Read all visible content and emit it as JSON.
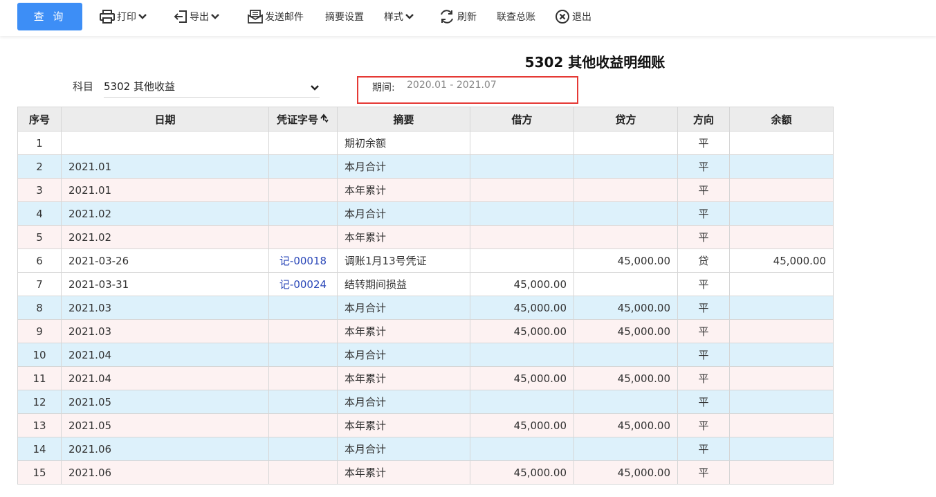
{
  "toolbar": {
    "query_label": "查 询",
    "print_label": "打印",
    "export_label": "导出",
    "send_mail_label": "发送邮件",
    "summary_settings_label": "摘要设置",
    "style_label": "样式",
    "refresh_label": "刷新",
    "linked_ledger_label": "联查总账",
    "exit_label": "退出"
  },
  "report": {
    "title": "5302 其他收益明细账"
  },
  "filters": {
    "subject_label": "科目",
    "subject_value": "5302 其他收益",
    "period_label": "期间:",
    "period_value": "2020.01 - 2021.07"
  },
  "colors": {
    "accent": "#3d8ef6",
    "highlight_border": "#e53935",
    "row_blue": "#ddf1fb",
    "row_pink": "#fdf2f2",
    "link": "#2a47b8"
  },
  "table": {
    "columns": [
      "序号",
      "日期",
      "凭证字号",
      "摘要",
      "借方",
      "贷方",
      "方向",
      "余额"
    ],
    "rows": [
      {
        "seq": "1",
        "date": "",
        "voucher": "",
        "summary": "期初余额",
        "debit": "",
        "credit": "",
        "direction": "平",
        "balance": ""
      },
      {
        "seq": "2",
        "date": "2021.01",
        "voucher": "",
        "summary": "本月合计",
        "debit": "",
        "credit": "",
        "direction": "平",
        "balance": ""
      },
      {
        "seq": "3",
        "date": "2021.01",
        "voucher": "",
        "summary": "本年累计",
        "debit": "",
        "credit": "",
        "direction": "平",
        "balance": ""
      },
      {
        "seq": "4",
        "date": "2021.02",
        "voucher": "",
        "summary": "本月合计",
        "debit": "",
        "credit": "",
        "direction": "平",
        "balance": ""
      },
      {
        "seq": "5",
        "date": "2021.02",
        "voucher": "",
        "summary": "本年累计",
        "debit": "",
        "credit": "",
        "direction": "平",
        "balance": ""
      },
      {
        "seq": "6",
        "date": "2021-03-26",
        "voucher": "记-00018",
        "summary": "调账1月13号凭证",
        "debit": "",
        "credit": "45,000.00",
        "direction": "贷",
        "balance": "45,000.00"
      },
      {
        "seq": "7",
        "date": "2021-03-31",
        "voucher": "记-00024",
        "summary": "结转期间损益",
        "debit": "45,000.00",
        "credit": "",
        "direction": "平",
        "balance": ""
      },
      {
        "seq": "8",
        "date": "2021.03",
        "voucher": "",
        "summary": "本月合计",
        "debit": "45,000.00",
        "credit": "45,000.00",
        "direction": "平",
        "balance": ""
      },
      {
        "seq": "9",
        "date": "2021.03",
        "voucher": "",
        "summary": "本年累计",
        "debit": "45,000.00",
        "credit": "45,000.00",
        "direction": "平",
        "balance": ""
      },
      {
        "seq": "10",
        "date": "2021.04",
        "voucher": "",
        "summary": "本月合计",
        "debit": "",
        "credit": "",
        "direction": "平",
        "balance": ""
      },
      {
        "seq": "11",
        "date": "2021.04",
        "voucher": "",
        "summary": "本年累计",
        "debit": "45,000.00",
        "credit": "45,000.00",
        "direction": "平",
        "balance": ""
      },
      {
        "seq": "12",
        "date": "2021.05",
        "voucher": "",
        "summary": "本月合计",
        "debit": "",
        "credit": "",
        "direction": "平",
        "balance": ""
      },
      {
        "seq": "13",
        "date": "2021.05",
        "voucher": "",
        "summary": "本年累计",
        "debit": "45,000.00",
        "credit": "45,000.00",
        "direction": "平",
        "balance": ""
      },
      {
        "seq": "14",
        "date": "2021.06",
        "voucher": "",
        "summary": "本月合计",
        "debit": "",
        "credit": "",
        "direction": "平",
        "balance": ""
      },
      {
        "seq": "15",
        "date": "2021.06",
        "voucher": "",
        "summary": "本年累计",
        "debit": "45,000.00",
        "credit": "45,000.00",
        "direction": "平",
        "balance": ""
      }
    ]
  }
}
